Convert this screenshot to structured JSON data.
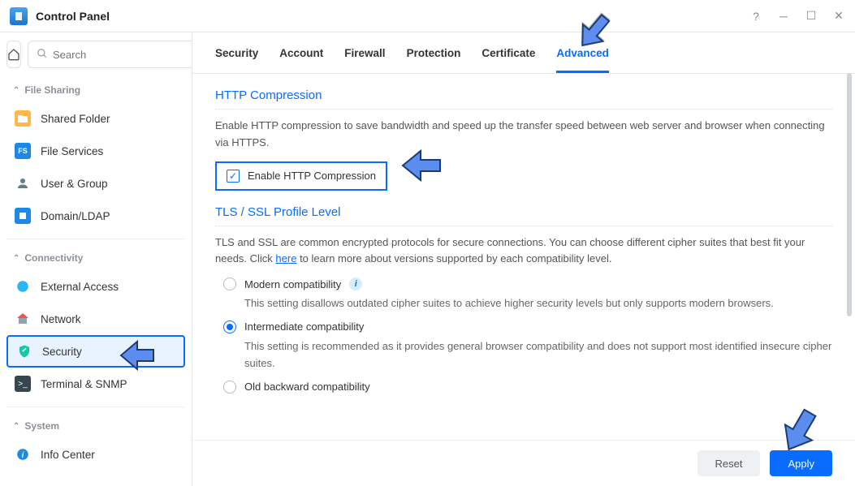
{
  "window": {
    "title": "Control Panel"
  },
  "sidebar": {
    "search_placeholder": "Search",
    "sections": {
      "file_sharing": "File Sharing",
      "connectivity": "Connectivity",
      "system": "System"
    },
    "items": {
      "shared_folder": "Shared Folder",
      "file_services": "File Services",
      "user_group": "User & Group",
      "domain_ldap": "Domain/LDAP",
      "external_access": "External Access",
      "network": "Network",
      "security": "Security",
      "terminal_snmp": "Terminal & SNMP",
      "info_center": "Info Center"
    }
  },
  "tabs": {
    "security": "Security",
    "account": "Account",
    "firewall": "Firewall",
    "protection": "Protection",
    "certificate": "Certificate",
    "advanced": "Advanced"
  },
  "sections": {
    "http_compression": {
      "title": "HTTP Compression",
      "desc": "Enable HTTP compression to save bandwidth and speed up the transfer speed between web server and browser when connecting via HTTPS.",
      "checkbox_label": "Enable HTTP Compression"
    },
    "tls": {
      "title": "TLS / SSL Profile Level",
      "desc_pre": "TLS and SSL are common encrypted protocols for secure connections. You can choose different cipher suites that best fit your needs. Click ",
      "desc_link": "here",
      "desc_post": " to learn more about versions supported by each compatibility level.",
      "options": {
        "modern": {
          "label": "Modern compatibility",
          "desc": "This setting disallows outdated cipher suites to achieve higher security levels but only supports modern browsers."
        },
        "intermediate": {
          "label": "Intermediate compatibility",
          "desc": "This setting is recommended as it provides general browser compatibility and does not support most identified insecure cipher suites."
        },
        "old": {
          "label": "Old backward compatibility"
        }
      }
    }
  },
  "footer": {
    "reset": "Reset",
    "apply": "Apply"
  }
}
